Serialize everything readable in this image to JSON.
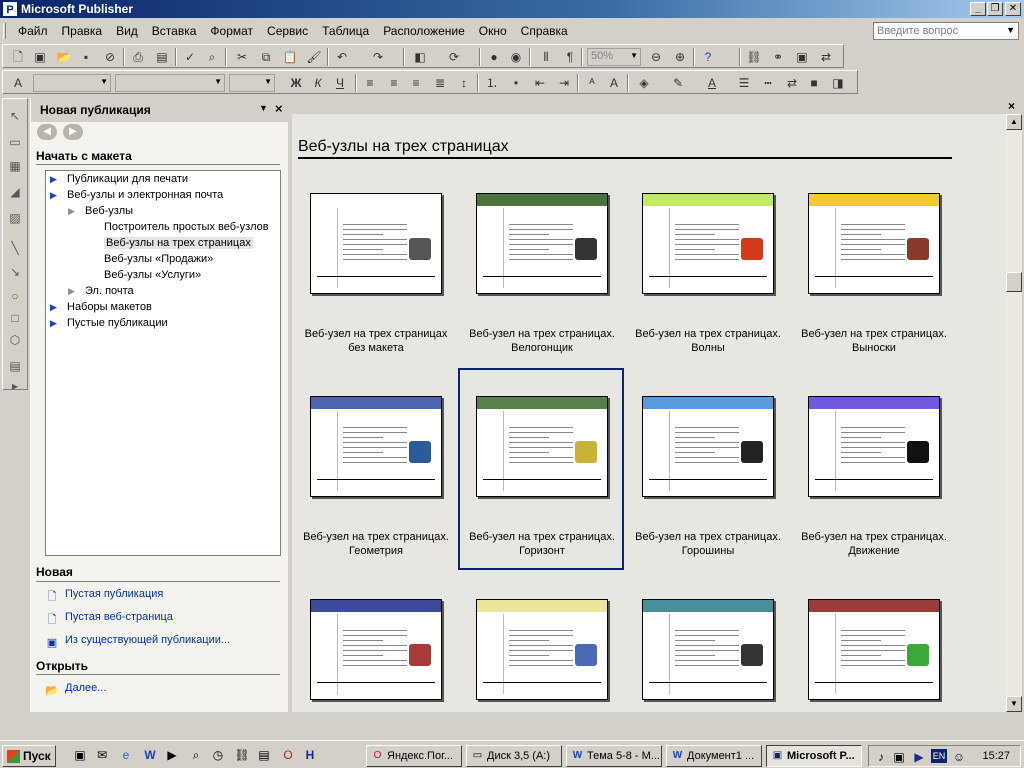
{
  "window": {
    "title": "Microsoft Publisher",
    "app_icon": "P"
  },
  "menu": {
    "items": [
      "Файл",
      "Правка",
      "Вид",
      "Вставка",
      "Формат",
      "Сервис",
      "Таблица",
      "Расположение",
      "Окно",
      "Справка"
    ],
    "help_placeholder": "Введите вопрос"
  },
  "toolbar": {
    "zoom": "50%"
  },
  "taskpane": {
    "title": "Новая публикация",
    "start_section": "Начать с макета",
    "tree": [
      {
        "label": "Публикации для печати",
        "level": 0,
        "expander": "blue"
      },
      {
        "label": "Веб-узлы и электронная почта",
        "level": 0,
        "expander": "blue"
      },
      {
        "label": "Веб-узлы",
        "level": 1,
        "expander": "gray"
      },
      {
        "label": "Построитель простых веб-узлов",
        "level": 2,
        "expander": ""
      },
      {
        "label": "Веб-узлы на трех страницах",
        "level": 2,
        "expander": "",
        "selected": true
      },
      {
        "label": "Веб-узлы «Продажи»",
        "level": 2,
        "expander": ""
      },
      {
        "label": "Веб-узлы «Услуги»",
        "level": 2,
        "expander": ""
      },
      {
        "label": "Эл. почта",
        "level": 1,
        "expander": "gray"
      },
      {
        "label": "Наборы макетов",
        "level": 0,
        "expander": "blue"
      },
      {
        "label": "Пустые публикации",
        "level": 0,
        "expander": "blue"
      }
    ],
    "new_section": "Новая",
    "new_links": [
      "Пустая публикация",
      "Пустая веб-страница",
      "Из существующей публикации..."
    ],
    "open_section": "Открыть",
    "open_links": [
      "Далее..."
    ]
  },
  "gallery": {
    "title": "Веб-узлы на трех страницах",
    "items": [
      {
        "line1": "Веб-узел на трех страницах",
        "line2": "без макета",
        "accent": "#ffffff",
        "img": "#555555"
      },
      {
        "line1": "Веб-узел на трех страницах.",
        "line2": "Велогонщик",
        "accent": "#2d5a1b",
        "img": "#333333"
      },
      {
        "line1": "Веб-узел на трех страницах.",
        "line2": "Волны",
        "accent": "#b8e64a",
        "img": "#d23a1a"
      },
      {
        "line1": "Веб-узел на трех страницах.",
        "line2": "Выноски",
        "accent": "#f2c20a",
        "img": "#8a3a2a"
      },
      {
        "line1": "Веб-узел на трех страницах.",
        "line2": "Геометрия",
        "accent": "#2b4aa0",
        "img": "#2d5a9a"
      },
      {
        "line1": "Веб-узел на трех страницах.",
        "line2": "Горизонт",
        "accent": "#3a6a2a",
        "img": "#c8b23a",
        "selected": true
      },
      {
        "line1": "Веб-узел на трех страницах.",
        "line2": "Горошины",
        "accent": "#3a8ad8",
        "img": "#222222"
      },
      {
        "line1": "Веб-узел на трех страницах.",
        "line2": "Движение",
        "accent": "#5a3ad8",
        "img": "#111111"
      },
      {
        "line1": "",
        "line2": "",
        "accent": "#1a2a8a",
        "img": "#a83a3a"
      },
      {
        "line1": "",
        "line2": "",
        "accent": "#e6e08a",
        "img": "#4a6ab8"
      },
      {
        "line1": "",
        "line2": "",
        "accent": "#2a7a8a",
        "img": "#333333"
      },
      {
        "line1": "",
        "line2": "",
        "accent": "#8a1a1a",
        "img": "#3aa83a"
      }
    ]
  },
  "taskbar": {
    "start": "Пуск",
    "tasks": [
      "Яндекс.Пог...",
      "Диск 3,5 (A:)",
      "Тема 5-8 - М...",
      "Документ1 ...",
      "Microsoft P..."
    ],
    "active_task": 4,
    "lang": "EN",
    "clock": "15:27"
  }
}
